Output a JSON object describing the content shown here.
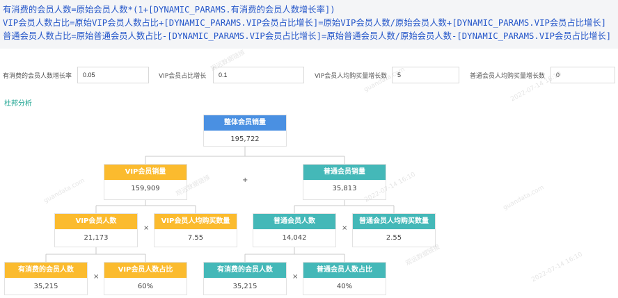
{
  "formulas": [
    "有消费的会员人数=原始会员人数*(1+[DYNAMIC_PARAMS.有消费的会员人数增长率])",
    "VIP会员人数占比=原始VIP会员人数占比+[DYNAMIC_PARAMS.VIP会员占比增长]=原始VIP会员人数/原始会员人数+[DYNAMIC_PARAMS.VIP会员占比增长]",
    "普通会员人数占比=原始普通会员人数占比-[DYNAMIC_PARAMS.VIP会员占比增长]=原始普通会员人数/原始会员人数-[DYNAMIC_PARAMS.VIP会员占比增长]"
  ],
  "params": [
    {
      "label": "有消费的会员人数增长率",
      "value": "0.05"
    },
    {
      "label": "VIP会员占比增长",
      "value": "0.1"
    },
    {
      "label": "VIP会员人均购买量增长数",
      "value": "5"
    },
    {
      "label": "普通会员人均购买量增长数",
      "value": "0"
    }
  ],
  "section_title": "杜邦分析",
  "tree": {
    "root": {
      "title": "整体会员销量",
      "value": "195,722"
    },
    "vip_sales": {
      "title": "VIP会员销量",
      "value": "159,909"
    },
    "normal_sales": {
      "title": "普通会员销量",
      "value": "35,813"
    },
    "vip_count": {
      "title": "VIP会员人数",
      "value": "21,173"
    },
    "vip_avg": {
      "title": "VIP会员人均购买数量",
      "value": "7.55"
    },
    "normal_count": {
      "title": "普通会员人数",
      "value": "14,042"
    },
    "normal_avg": {
      "title": "普通会员人均购买数量",
      "value": "2.55"
    },
    "vip_consumers": {
      "title": "有消费的会员人数",
      "value": "35,215"
    },
    "vip_ratio": {
      "title": "VIP会员人数占比",
      "value": "60%"
    },
    "normal_consumers": {
      "title": "有消费的会员人数",
      "value": "35,215"
    },
    "normal_ratio": {
      "title": "普通会员人数占比",
      "value": "40%"
    }
  },
  "operators": {
    "plus": "+",
    "times": "×"
  },
  "watermark": [
    "观远数据链接",
    "guandata.com",
    "2022-07-14 16:10"
  ]
}
